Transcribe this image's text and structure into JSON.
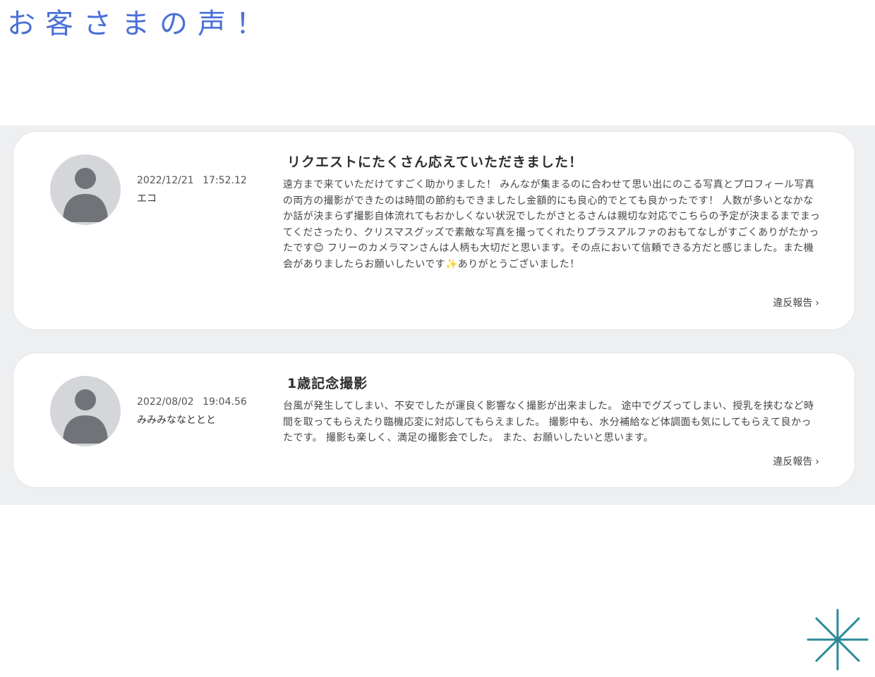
{
  "page": {
    "title": "お客さまの声！"
  },
  "reviews": [
    {
      "date": "2022/12/21 17:52.12",
      "name": "エコ",
      "title": "リクエストにたくさん応えていただきました！",
      "body": "遠方まで来ていただけてすごく助かりました！ みんなが集まるのに合わせて思い出にのこる写真とプロフィール写真の両方の撮影ができたのは時間の節約もできましたし金額的にも良心的でとても良かったです！ 人数が多いとなかなか話が決まらず撮影自体流れてもおかしくない状況でしたがさとるさんは親切な対応でこちらの予定が決まるまでまってくださったり、クリスマスグッズで素敵な写真を撮ってくれたりプラスアルファのおもてなしがすごくありがたかったです😊 フリーのカメラマンさんは人柄も大切だと思います。その点において信頼できる方だと感じました。また機会がありましたらお願いしたいです✨ありがとうございました！",
      "report_label": "違反報告"
    },
    {
      "date": "2022/08/02 19:04.56",
      "name": "みみみななととと",
      "title": "1歳記念撮影",
      "body": "台風が発生してしまい、不安でしたが運良く影響なく撮影が出来ました。 途中でグズってしまい、授乳を挟むなど時間を取ってもらえたり臨機応変に対応してもらえました。 撮影中も、水分補給など体調面も気にしてもらえて良かったです。 撮影も楽しく、満足の撮影会でした。 また、お願いしたいと思います。",
      "report_label": "違反報告"
    }
  ],
  "icons": {
    "avatar": "default-user-icon",
    "report_arrow": "chevron-right-icon",
    "decoration": "asterisk-sparkle-icon"
  },
  "colors": {
    "title": "#4a70d8",
    "band_background": "#eeeff1",
    "avatar_bg": "#d5d6d9",
    "avatar_fg": "#707378",
    "decoration": "#2a8a96"
  }
}
